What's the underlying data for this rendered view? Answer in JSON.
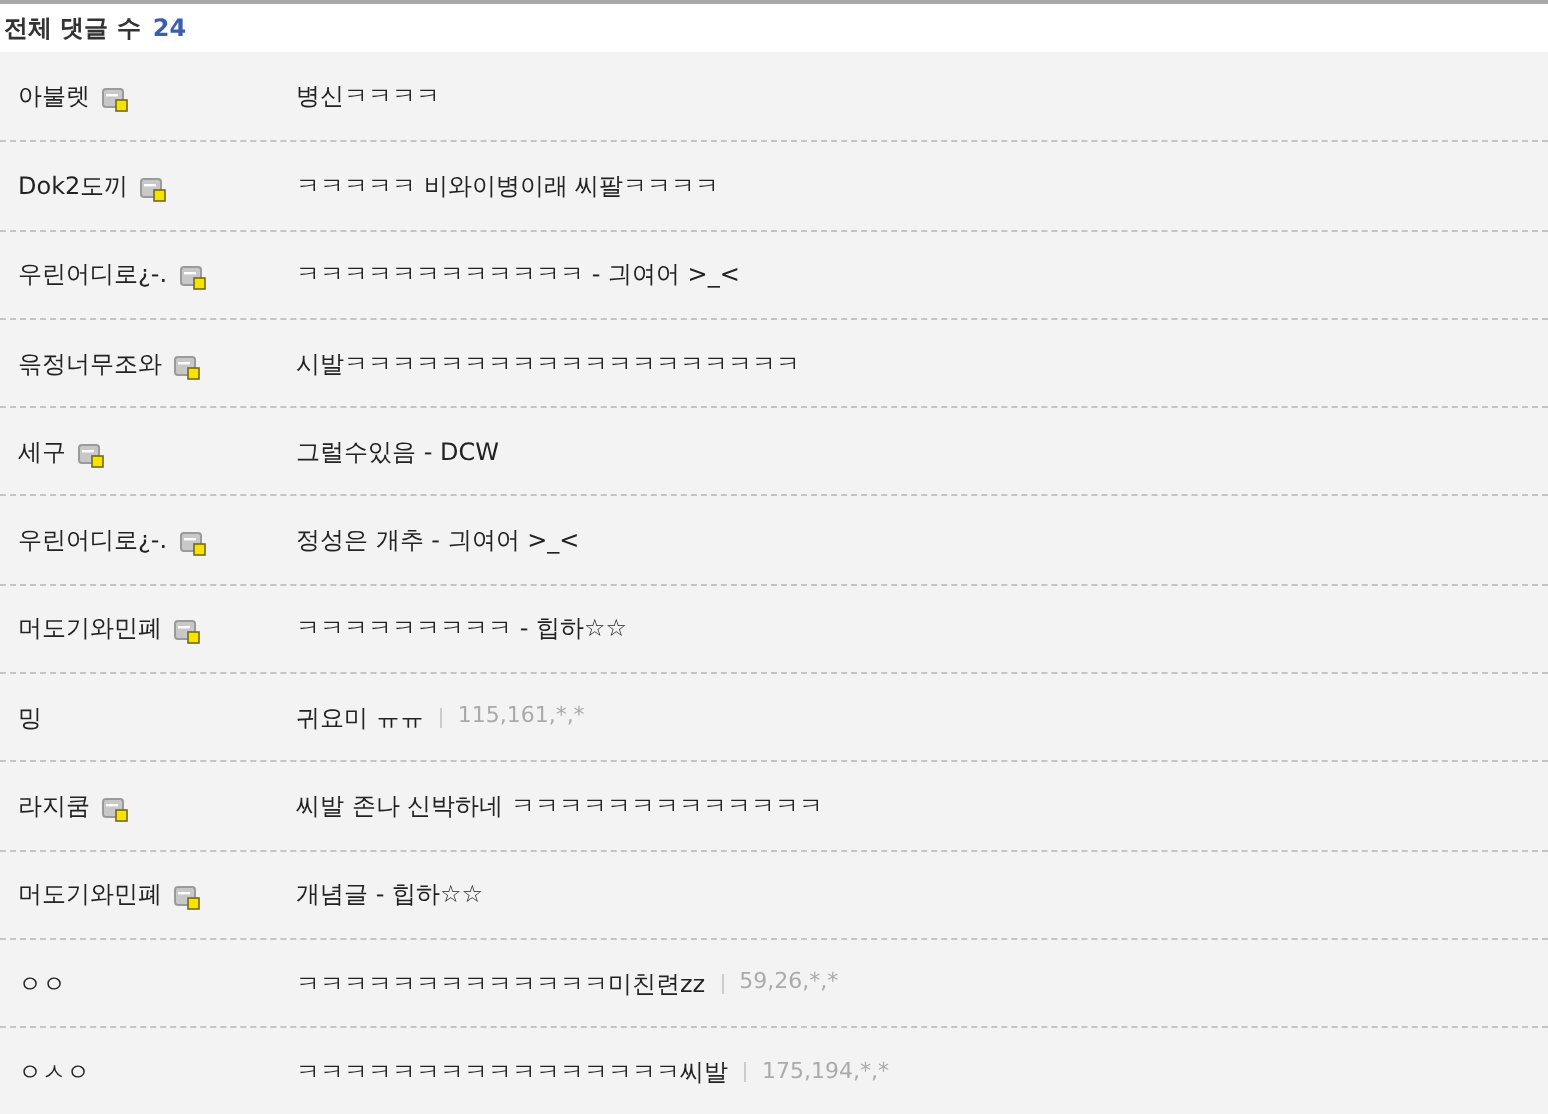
{
  "header": {
    "label": "전체 댓글 수",
    "count": "24"
  },
  "comments": [
    {
      "name": "아불렛",
      "fixed_nick": true,
      "text": "병신ㅋㅋㅋㅋ"
    },
    {
      "name": "Dok2도끼",
      "fixed_nick": true,
      "text": "ㅋㅋㅋㅋㅋ 비와이병이래 씨팔ㅋㅋㅋㅋ"
    },
    {
      "name": "우린어디로¿-.",
      "fixed_nick": true,
      "text": "ㅋㅋㅋㅋㅋㅋㅋㅋㅋㅋㅋㅋ - 긔여어 >_<"
    },
    {
      "name": "윾정너무조와",
      "fixed_nick": true,
      "text": "시발ㅋㅋㅋㅋㅋㅋㅋㅋㅋㅋㅋㅋㅋㅋㅋㅋㅋㅋㅋ"
    },
    {
      "name": "세구",
      "fixed_nick": true,
      "text": "그럴수있음 - DCW"
    },
    {
      "name": "우린어디로¿-.",
      "fixed_nick": true,
      "text": "정성은 개추 - 긔여어 >_<"
    },
    {
      "name": "머도기와민폐",
      "fixed_nick": true,
      "text": "ㅋㅋㅋㅋㅋㅋㅋㅋㅋ - 힙하☆☆"
    },
    {
      "name": "밍",
      "fixed_nick": false,
      "text": "귀요미 ㅠㅠ",
      "ip": "115,161,*,*"
    },
    {
      "name": "라지쿰",
      "fixed_nick": true,
      "text": "씨발 존나 신박하네 ㅋㅋㅋㅋㅋㅋㅋㅋㅋㅋㅋㅋㅋ"
    },
    {
      "name": "머도기와민폐",
      "fixed_nick": true,
      "text": "개념글 - 힙하☆☆"
    },
    {
      "name": "ㅇㅇ",
      "fixed_nick": false,
      "text": "ㅋㅋㅋㅋㅋㅋㅋㅋㅋㅋㅋㅋㅋ미친련zz",
      "ip": "59,26,*,*"
    },
    {
      "name": "ㅇㅅㅇ",
      "fixed_nick": false,
      "text": "ㅋㅋㅋㅋㅋㅋㅋㅋㅋㅋㅋㅋㅋㅋㅋㅋ씨발",
      "ip": "175,194,*,*"
    }
  ]
}
